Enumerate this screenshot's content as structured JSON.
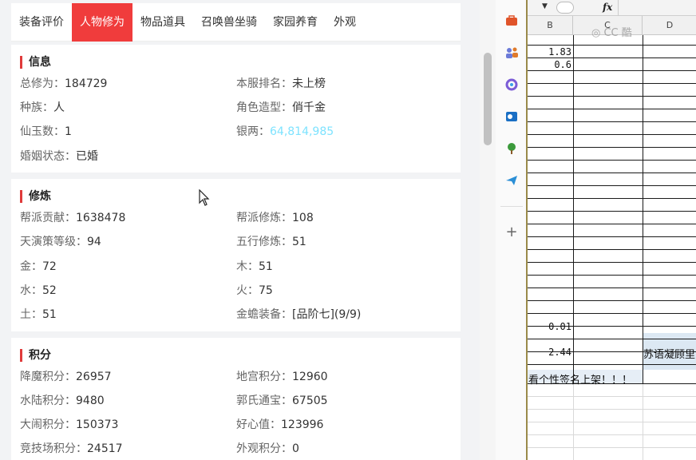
{
  "tabs": [
    {
      "label": "装备评价",
      "active": false
    },
    {
      "label": "人物修为",
      "active": true
    },
    {
      "label": "物品道具",
      "active": false
    },
    {
      "label": "召唤兽坐骑",
      "active": false
    },
    {
      "label": "家园养育",
      "active": false
    },
    {
      "label": "外观",
      "active": false
    }
  ],
  "info": {
    "title": "信息",
    "total_cultivation_label": "总修为：",
    "total_cultivation": "184729",
    "server_rank_label": "本服排名：",
    "server_rank": "未上榜",
    "race_label": "种族：",
    "race": "人",
    "model_label": "角色造型：",
    "model": "俏千金",
    "jade_label": "仙玉数：",
    "jade": "1",
    "silver_label": "银两：",
    "silver": "64,814,985",
    "marriage_label": "婚姻状态：",
    "marriage": "已婚"
  },
  "cultivation": {
    "title": "修炼",
    "guild_contrib_label": "帮派贡献：",
    "guild_contrib": "1638478",
    "guild_cult_label": "帮派修炼：",
    "guild_cult": "108",
    "tianyan_label": "天演策等级：",
    "tianyan": "94",
    "wuxing_label": "五行修炼：",
    "wuxing": "51",
    "metal_label": "金：",
    "metal": "72",
    "wood_label": "木：",
    "wood": "51",
    "water_label": "水：",
    "water": "52",
    "fire_label": "火：",
    "fire": "75",
    "earth_label": "土：",
    "earth": "51",
    "toad_label": "金蟾装备：",
    "toad": "[品阶七](9/9)"
  },
  "points": {
    "title": "积分",
    "demon_label": "降魔积分：",
    "demon": "26957",
    "palace_label": "地宫积分：",
    "palace": "12960",
    "landwater_label": "水陆积分：",
    "landwater": "9480",
    "guo_label": "郭氏通宝：",
    "guo": "67505",
    "havoc_label": "大闹积分：",
    "havoc": "150373",
    "kind_label": "好心值：",
    "kind": "123996",
    "arena_label": "竞技场积分：",
    "arena": "24517",
    "look_label": "外观积分：",
    "look": "0"
  },
  "spreadsheet": {
    "fx_label": "fx",
    "columns": [
      "B",
      "C",
      "D"
    ],
    "values": [
      "1.83",
      "0.6",
      "0.01",
      "2.44"
    ],
    "text_d": "苏语凝顾里",
    "text_row": "看个性签名上架！！！"
  },
  "colors": {
    "accent": "#f03c3c",
    "silver": "#7ee3ff"
  }
}
